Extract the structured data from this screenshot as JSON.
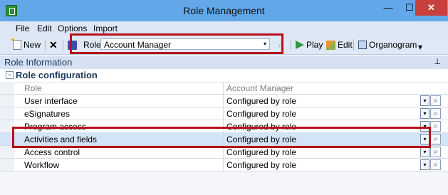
{
  "window": {
    "title": "Role Management",
    "minimize": "—",
    "maximize": "☐",
    "close": "✕"
  },
  "menu": [
    "File",
    "Edit",
    "Options",
    "Import"
  ],
  "toolbar": {
    "new_label": "New",
    "delete_glyph": "✕",
    "role_label": "Role:",
    "role_value": "Account Manager",
    "play_label": "Play",
    "edit_label": "Edit",
    "organogram_label": "Organogram",
    "more_glyph": "▾"
  },
  "panel": {
    "title": "Role Information",
    "pin_glyph": "⊥"
  },
  "section": {
    "collapse_glyph": "−",
    "title": "Role configuration"
  },
  "grid": {
    "header": {
      "name": "Role",
      "value": "Account Manager"
    },
    "rows": [
      {
        "name": "User interface",
        "value": "Configured by role"
      },
      {
        "name": "eSignatures",
        "value": "Configured by role"
      },
      {
        "name": "Program access",
        "value": "Configured by role"
      },
      {
        "name": "Activities and fields",
        "value": "Configured by role"
      },
      {
        "name": "Access control",
        "value": "Configured by role"
      },
      {
        "name": "Workflow",
        "value": "Configured by role"
      }
    ],
    "drop_glyph": "▾",
    "search_glyph": "⌕"
  },
  "colors": {
    "title_bar": "#62a8e8",
    "highlight": "#b5121b",
    "selected_row": "#d4e4f7"
  }
}
